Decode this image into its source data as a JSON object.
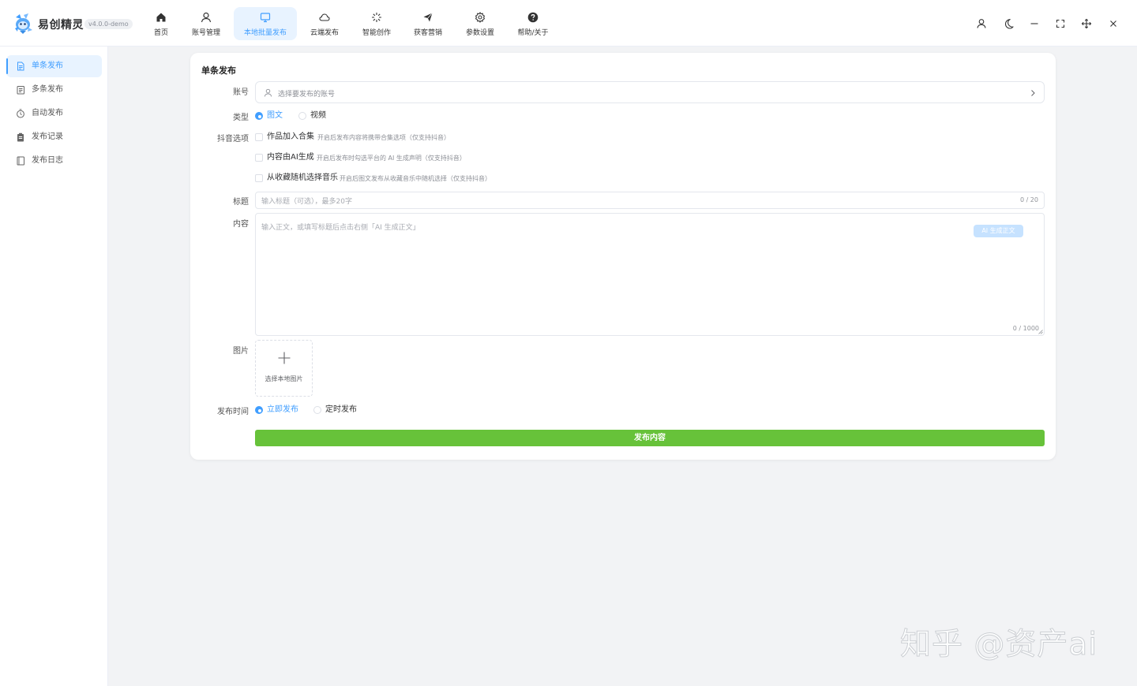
{
  "app": {
    "name": "易创精灵",
    "version": "v4.0.0-demo",
    "brand_color": "#409eff"
  },
  "nav": {
    "items": [
      {
        "label": "首页",
        "icon": "home-icon"
      },
      {
        "label": "账号管理",
        "icon": "user-icon"
      },
      {
        "label": "本地批量发布",
        "icon": "monitor-icon",
        "active": true
      },
      {
        "label": "云端发布",
        "icon": "cloud-icon"
      },
      {
        "label": "智能创作",
        "icon": "sparkle-icon"
      },
      {
        "label": "获客营销",
        "icon": "send-icon"
      },
      {
        "label": "参数设置",
        "icon": "gear-icon"
      },
      {
        "label": "帮助/关于",
        "icon": "help-icon"
      }
    ]
  },
  "window_controls": [
    "user-icon",
    "moon-icon",
    "minimize-icon",
    "fullscreen-icon",
    "move-icon",
    "close-icon"
  ],
  "sidebar": {
    "items": [
      {
        "label": "单条发布",
        "icon": "document-icon",
        "active": true
      },
      {
        "label": "多条发布",
        "icon": "documents-icon"
      },
      {
        "label": "自动发布",
        "icon": "timer-icon"
      },
      {
        "label": "发布记录",
        "icon": "clipboard-icon"
      },
      {
        "label": "发布日志",
        "icon": "notebook-icon"
      }
    ]
  },
  "form": {
    "title": "单条发布",
    "account": {
      "label": "账号",
      "placeholder": "选择要发布的账号"
    },
    "type": {
      "label": "类型",
      "options": [
        "图文",
        "视频"
      ],
      "selected": "图文"
    },
    "douyin": {
      "label": "抖音选项",
      "options": [
        {
          "label": "作品加入合集",
          "hint": "开启后发布内容将携带合集选项（仅支持抖音）",
          "checked": false
        },
        {
          "label": "内容由AI生成",
          "hint": "开启后发布时勾选平台的 AI 生成声明（仅支持抖音）",
          "checked": false
        },
        {
          "label": "从收藏随机选择音乐",
          "hint": "开启后图文发布从收藏音乐中随机选择（仅支持抖音）",
          "checked": false
        }
      ]
    },
    "title_field": {
      "label": "标题",
      "placeholder": "输入标题（可选），最多20字",
      "counter": "0 / 20"
    },
    "content": {
      "label": "内容",
      "placeholder": "输入正文，或填写标题后点击右侧「AI 生成正文」",
      "ai_button": "AI 生成正文",
      "counter": "0 / 1000"
    },
    "images": {
      "label": "图片",
      "upload_label": "选择本地图片"
    },
    "publish_time": {
      "label": "发布时间",
      "options": [
        "立即发布",
        "定时发布"
      ],
      "selected": "立即发布"
    },
    "submit": "发布内容",
    "submit_color": "#67c23a"
  },
  "watermark": "知乎 @资产ai"
}
